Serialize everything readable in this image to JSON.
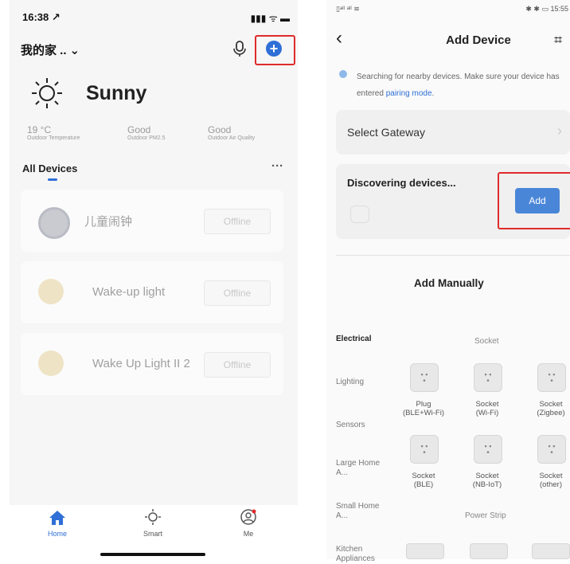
{
  "left": {
    "status": {
      "time": "16:38 ↗",
      "icons": "▮▮▮ ᯤ ▬"
    },
    "header": {
      "home_name": "我的家 ..",
      "chevron": "⌄"
    },
    "weather": {
      "condition": "Sunny",
      "stats": [
        {
          "value": "19 °C",
          "label": "Outdoor Temperature"
        },
        {
          "value": "Good",
          "label": "Outdoor PM2.5"
        },
        {
          "value": "Good",
          "label": "Outdoor Air Quality"
        }
      ]
    },
    "devices_title": "All Devices",
    "more": "···",
    "devices": [
      {
        "name": "儿童闹钟",
        "status": "Offline"
      },
      {
        "name": "Wake-up light",
        "status": "Offline"
      },
      {
        "name": "Wake Up Light II 2",
        "status": "Offline"
      }
    ],
    "tabs": [
      {
        "label": "Home",
        "icon": "home-icon"
      },
      {
        "label": "Smart",
        "icon": "sun-icon"
      },
      {
        "label": "Me",
        "icon": "person-icon"
      }
    ],
    "colors": {
      "accent": "#2f6fd6",
      "highlight": "#e02b2b"
    }
  },
  "right": {
    "status": {
      "left": "▯ᵃˡˡ ᵃˡˡ ≋",
      "right": "✱ ✱ ▭ 15:55"
    },
    "header": {
      "back": "‹",
      "title": "Add Device",
      "scan": "⌗"
    },
    "search_notice": {
      "prefix": "Searching for nearby devices. Make sure your device has entered ",
      "link": "pairing mode",
      "suffix": "."
    },
    "gateway": {
      "label": "Select Gateway",
      "chevron": "›"
    },
    "discovering": {
      "label": "Discovering devices...",
      "button": "Add"
    },
    "manual_title": "Add Manually",
    "categories": [
      "Electrical",
      "Lighting",
      "Sensors",
      "Large Home A...",
      "Small Home A...",
      "Kitchen Appliances"
    ],
    "section_socket": "Socket",
    "sockets": [
      {
        "line1": "Plug",
        "line2": "(BLE+Wi-Fi)"
      },
      {
        "line1": "Socket",
        "line2": "(Wi-Fi)"
      },
      {
        "line1": "Socket",
        "line2": "(Zigbee)"
      },
      {
        "line1": "Socket",
        "line2": "(BLE)"
      },
      {
        "line1": "Socket",
        "line2": "(NB-IoT)"
      },
      {
        "line1": "Socket",
        "line2": "(other)"
      }
    ],
    "section_power_strip": "Power Strip"
  }
}
